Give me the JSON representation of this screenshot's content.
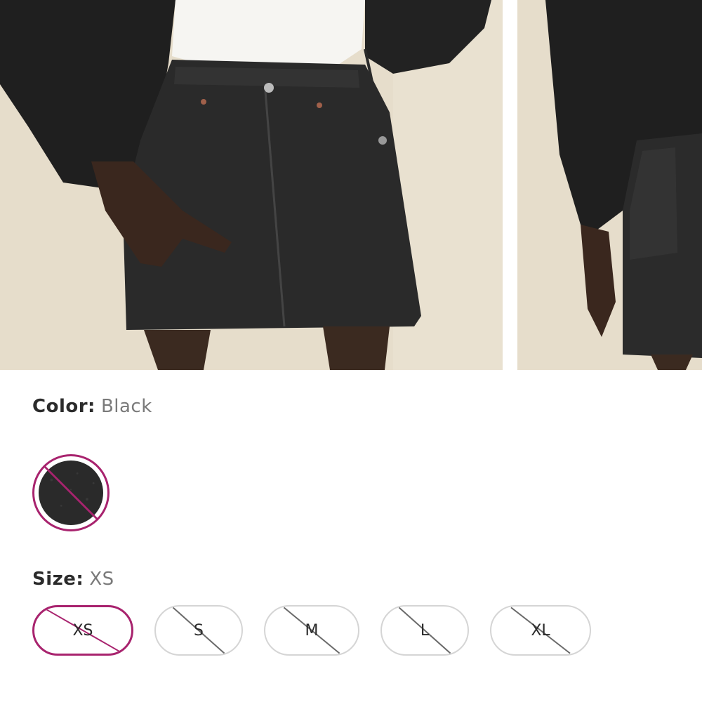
{
  "gallery": {
    "images": [
      {
        "alt_name": "skirt-front-photo"
      },
      {
        "alt_name": "skirt-side-photo"
      }
    ]
  },
  "color": {
    "label": "Color:",
    "selected": "Black",
    "swatches": [
      {
        "name": "Black",
        "swatch_color": "#2a2a2a",
        "unavailable": true,
        "selected": true
      }
    ]
  },
  "size": {
    "label": "Size:",
    "selected": "XS",
    "options": [
      {
        "label": "XS",
        "unavailable": true,
        "selected": true
      },
      {
        "label": "S",
        "unavailable": true,
        "selected": false
      },
      {
        "label": "M",
        "unavailable": true,
        "selected": false
      },
      {
        "label": "L",
        "unavailable": true,
        "selected": false
      },
      {
        "label": "XL",
        "unavailable": true,
        "selected": false
      }
    ]
  },
  "colors": {
    "accent": "#a8236e",
    "strike_gray": "#6a6a6a",
    "border_gray": "#d5d5d5"
  }
}
